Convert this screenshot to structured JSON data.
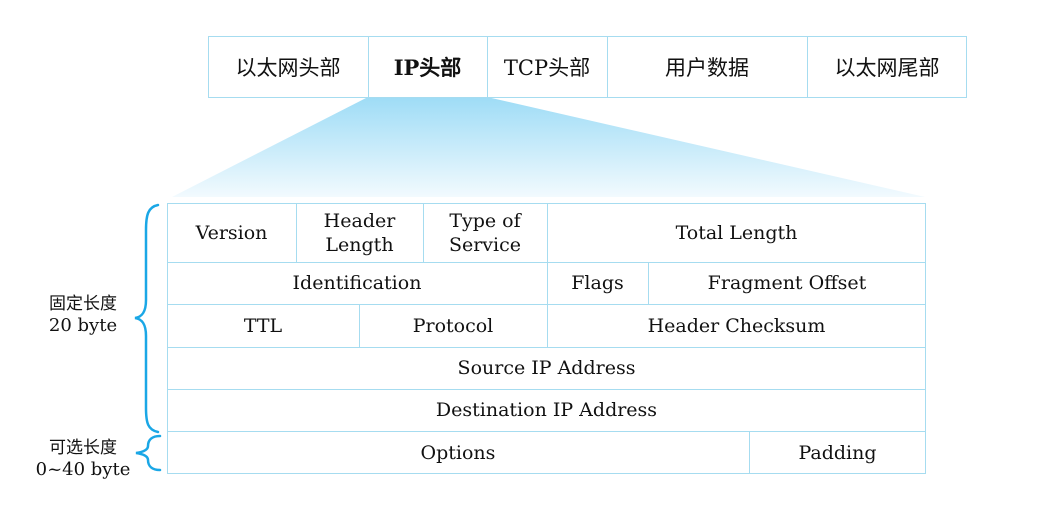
{
  "colors": {
    "border": "#a6dcf0",
    "brace": "#1aa7e6",
    "fan_top": "#9edcf6",
    "fan_bottom": "#f2fafe",
    "text": "#111111"
  },
  "ethernet_frame": {
    "segments": [
      {
        "label": "以太网头部"
      },
      {
        "label": "IP头部",
        "highlighted": true
      },
      {
        "label": "TCP头部"
      },
      {
        "label": "用户数据"
      },
      {
        "label": "以太网尾部"
      }
    ]
  },
  "ip_header": {
    "rows": [
      {
        "fields": [
          {
            "label": "Version"
          },
          {
            "label": "Header Length",
            "lines": [
              "Header",
              "Length"
            ]
          },
          {
            "label": "Type of Service",
            "lines": [
              "Type of",
              "Service"
            ]
          },
          {
            "label": "Total Length"
          }
        ]
      },
      {
        "fields": [
          {
            "label": "Identification"
          },
          {
            "label": "Flags"
          },
          {
            "label": "Fragment Offset"
          }
        ]
      },
      {
        "fields": [
          {
            "label": "TTL"
          },
          {
            "label": "Protocol"
          },
          {
            "label": "Header Checksum"
          }
        ]
      },
      {
        "fields": [
          {
            "label": "Source IP Address"
          }
        ]
      },
      {
        "fields": [
          {
            "label": "Destination IP Address"
          }
        ]
      },
      {
        "fields": [
          {
            "label": "Options"
          },
          {
            "label": "Padding"
          }
        ]
      }
    ]
  },
  "annotations": {
    "fixed": {
      "title": "固定长度",
      "size": "20 byte"
    },
    "optional": {
      "title": "可选长度",
      "size": "0~40 byte"
    }
  }
}
